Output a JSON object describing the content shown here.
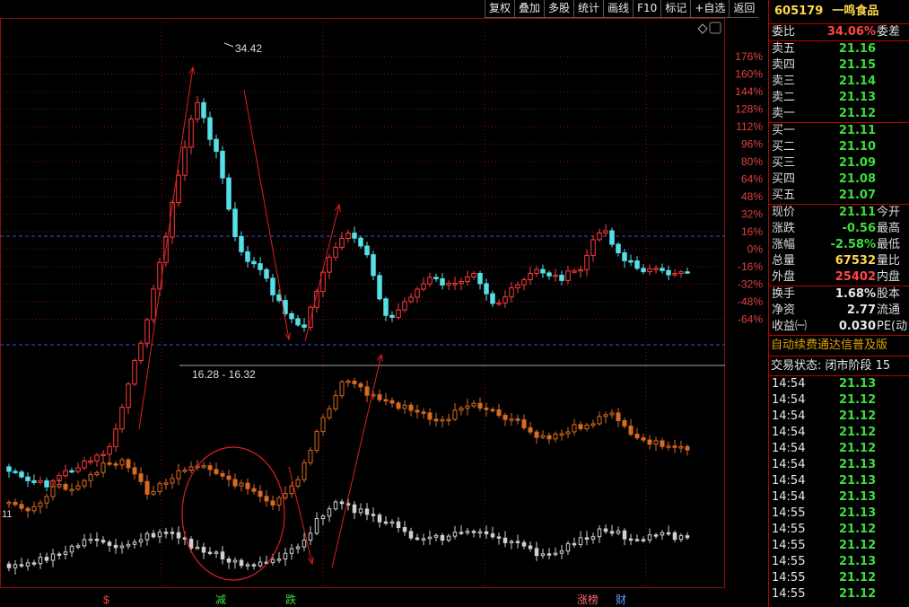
{
  "toolbar": {
    "items": [
      "复权",
      "叠加",
      "多股",
      "统计",
      "画线",
      "F10",
      "标记",
      "+自选",
      "返回"
    ]
  },
  "chart": {
    "y_axis_labels": [
      "176%",
      "160%",
      "144%",
      "128%",
      "112%",
      "96%",
      "80%",
      "64%",
      "48%",
      "32%",
      "16%",
      "0%",
      "-16%",
      "-32%",
      "-48%",
      "-64%"
    ],
    "high_label": "34.42",
    "low_label": "16.28 - 16.32",
    "left_mark": "11",
    "bottom_marks": [
      "$",
      "减",
      "跌",
      "涨榜",
      "财"
    ],
    "colors": {
      "up": "#ff3b3b",
      "down": "#55e0e8",
      "orange": "#d86a22",
      "gray": "#cfcfcf",
      "grid": "#8a1010",
      "dash": "#3a4fc8",
      "arrow": "#e02020"
    }
  },
  "quote": {
    "code": "605179",
    "name": "一鸣食品",
    "weibi": {
      "label": "委比",
      "value": "34.06%",
      "right": "委差"
    },
    "asks": [
      {
        "label": "卖五",
        "price": "21.16"
      },
      {
        "label": "卖四",
        "price": "21.15"
      },
      {
        "label": "卖三",
        "price": "21.14"
      },
      {
        "label": "卖二",
        "price": "21.13"
      },
      {
        "label": "卖一",
        "price": "21.12"
      }
    ],
    "bids": [
      {
        "label": "买一",
        "price": "21.11"
      },
      {
        "label": "买二",
        "price": "21.10"
      },
      {
        "label": "买三",
        "price": "21.09"
      },
      {
        "label": "买四",
        "price": "21.08"
      },
      {
        "label": "买五",
        "price": "21.07"
      }
    ],
    "stats1": [
      {
        "label": "现价",
        "value": "21.11",
        "right": "今开"
      },
      {
        "label": "涨跌",
        "value": "-0.56",
        "right": "最高"
      },
      {
        "label": "涨幅",
        "value": "-2.58%",
        "right": "最低"
      },
      {
        "label": "总量",
        "value": "67532",
        "right": "量比"
      },
      {
        "label": "外盘",
        "value": "25402",
        "right": "内盘"
      }
    ],
    "stats2": [
      {
        "label": "换手",
        "value": "1.68%",
        "right": "股本"
      },
      {
        "label": "净资",
        "value": "2.77",
        "right": "流通"
      },
      {
        "label": "收益㈠",
        "value": "0.030",
        "right": "PE(动"
      }
    ],
    "ticker": "自动续费通达信普及版",
    "status": "交易状态: 闭市阶段 15",
    "trades": [
      {
        "time": "14:54",
        "price": "21.13"
      },
      {
        "time": "14:54",
        "price": "21.12"
      },
      {
        "time": "14:54",
        "price": "21.12"
      },
      {
        "time": "14:54",
        "price": "21.12"
      },
      {
        "time": "14:54",
        "price": "21.12"
      },
      {
        "time": "14:54",
        "price": "21.13"
      },
      {
        "time": "14:54",
        "price": "21.13"
      },
      {
        "time": "14:54",
        "price": "21.13"
      },
      {
        "time": "14:55",
        "price": "21.13"
      },
      {
        "time": "14:55",
        "price": "21.12"
      },
      {
        "time": "14:55",
        "price": "21.12"
      },
      {
        "time": "14:55",
        "price": "21.13"
      },
      {
        "time": "14:55",
        "price": "21.12"
      },
      {
        "time": "14:55",
        "price": "21.12"
      }
    ]
  }
}
